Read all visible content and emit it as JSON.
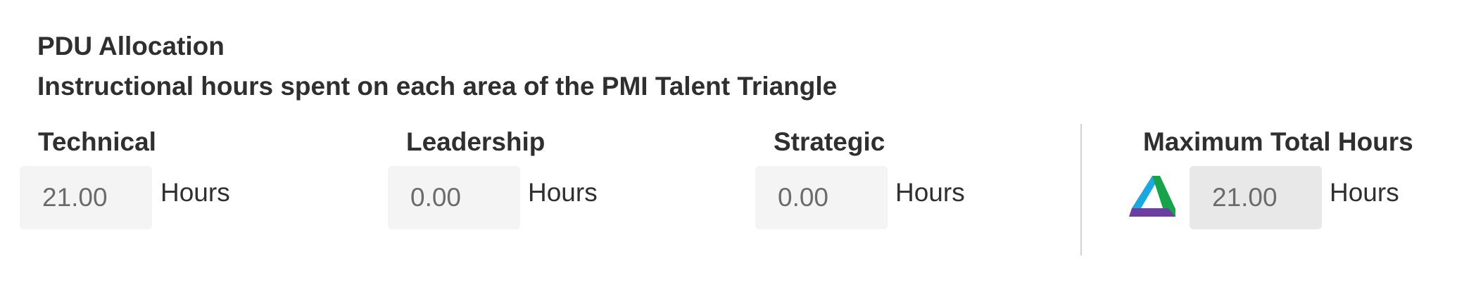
{
  "section": {
    "title": "PDU Allocation",
    "subtitle": "Instructional hours spent on each area of the PMI Talent Triangle"
  },
  "fields": {
    "technical": {
      "label": "Technical",
      "value": "21.00",
      "unit": "Hours"
    },
    "leadership": {
      "label": "Leadership",
      "value": "0.00",
      "unit": "Hours"
    },
    "strategic": {
      "label": "Strategic",
      "value": "0.00",
      "unit": "Hours"
    },
    "total": {
      "label": "Maximum Total Hours",
      "value": "21.00",
      "unit": "Hours"
    }
  },
  "icons": {
    "talent_triangle": "pmi-talent-triangle-icon"
  },
  "colors": {
    "triangle_blue": "#1ba7e0",
    "triangle_green": "#16a34a",
    "triangle_purple": "#6b3fa0",
    "input_background": "#f4f4f4",
    "total_input_background": "#e8e8e8",
    "divider": "#d2d2d2"
  }
}
